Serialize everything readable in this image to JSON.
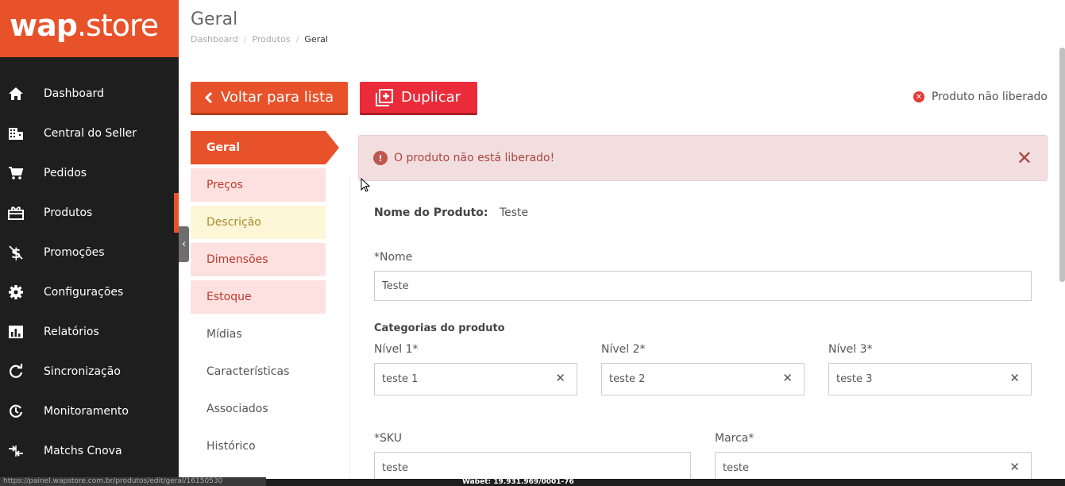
{
  "brand": {
    "logo_bold": "wap",
    "logo_rest": ".store",
    "accent": "#e8522a"
  },
  "sidebar": {
    "items": [
      {
        "label": "Dashboard",
        "icon": "home-icon"
      },
      {
        "label": "Central do Seller",
        "icon": "building-icon"
      },
      {
        "label": "Pedidos",
        "icon": "cart-icon"
      },
      {
        "label": "Produtos",
        "icon": "gift-icon",
        "active": true
      },
      {
        "label": "Promoções",
        "icon": "dollar-icon"
      },
      {
        "label": "Configurações",
        "icon": "gear-icon"
      },
      {
        "label": "Relatórios",
        "icon": "chart-icon"
      },
      {
        "label": "Sincronização",
        "icon": "sync-icon"
      },
      {
        "label": "Monitoramento",
        "icon": "monitor-icon"
      },
      {
        "label": "Matchs Cnova",
        "icon": "merge-icon"
      }
    ]
  },
  "header": {
    "title": "Geral",
    "breadcrumb": [
      "Dashboard",
      "Produtos",
      "Geral"
    ]
  },
  "actions": {
    "back": "Voltar para lista",
    "duplicate": "Duplicar"
  },
  "status": {
    "text": "Produto não liberado"
  },
  "tabs": [
    "Geral",
    "Preços",
    "Descrição",
    "Dimensões",
    "Estoque",
    "Mídias",
    "Características",
    "Associados",
    "Histórico"
  ],
  "alert": {
    "text": "O produto não está liberado!"
  },
  "form": {
    "product_name_label": "Nome do Produto:",
    "product_name_value": "Teste",
    "nome_label": "*Nome",
    "nome_value": "Teste",
    "categories_title": "Categorias do produto",
    "nivel1_label": "Nível 1*",
    "nivel1_value": "teste 1",
    "nivel2_label": "Nível 2*",
    "nivel2_value": "teste 2",
    "nivel3_label": "Nível 3*",
    "nivel3_value": "teste 3",
    "sku_label": "*SKU",
    "sku_value": "teste",
    "marca_label": "Marca*",
    "marca_value": "teste"
  },
  "footer": {
    "url": "https://painel.wapstore.com.br/produtos/edit/geral/16150530",
    "cnpj": "Wabet: 19.931.969/0001-76"
  }
}
